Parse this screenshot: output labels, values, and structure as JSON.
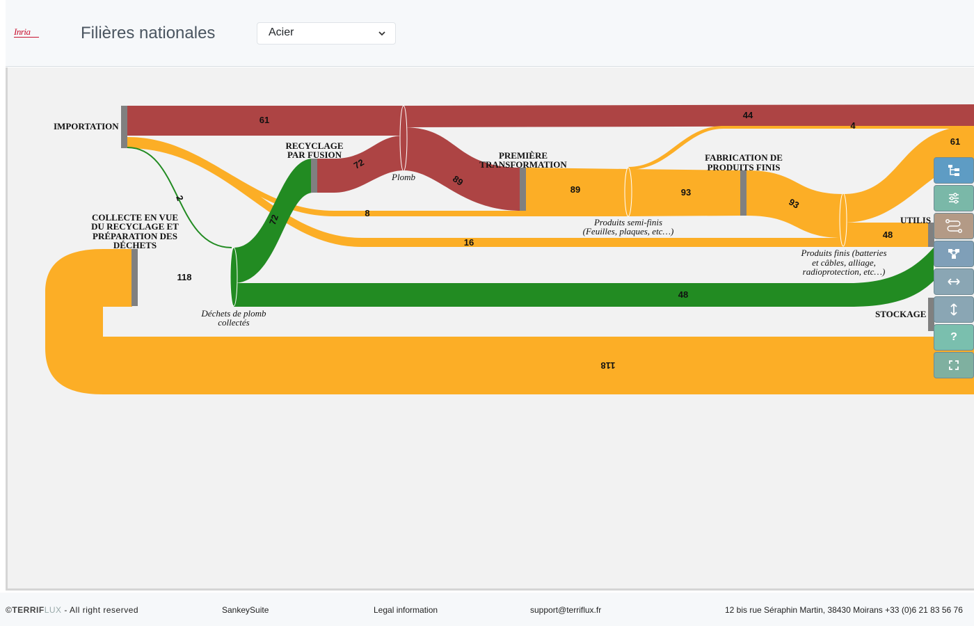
{
  "header": {
    "logo_text": "Inria",
    "title": "Filières nationales",
    "material_select": {
      "value": "Acier"
    }
  },
  "sankey": {
    "nodes": {
      "importation": "IMPORTATION",
      "collecte": [
        "COLLECTE EN VUE",
        "DU RECYCLAGE ET",
        "PRÉPARATION DES",
        "DÉCHETS"
      ],
      "recyclage": [
        "RECYCLAGE",
        "PAR FUSION"
      ],
      "premiere": [
        "PREMIÈRE",
        "TRANSFORMATION"
      ],
      "fabrication": [
        "FABRICATION DE",
        "PRODUITS FINIS"
      ],
      "utilisation": "UTILIS",
      "stockage": "STOCKAGE"
    },
    "products": {
      "plomb": "Plomb",
      "dechets": [
        "Déchets de plomb",
        "collectés"
      ],
      "semi_finis": [
        "Produits semi-finis",
        "(Feuilles, plaques, etc…)"
      ],
      "finis": [
        "Produits finis (batteries",
        "et câbles, alliage,",
        "radioprotection, etc…)"
      ]
    },
    "flow_values": {
      "import_plomb": "61",
      "plomb_export": "44",
      "orange_top": "4",
      "util_61": "61",
      "import_collecte": "2",
      "import_8": "8",
      "import_16": "16",
      "recycl_plomb": "72",
      "collecte_recycl": "72",
      "plomb_premiere": "89",
      "premiere_semi": "89",
      "semi_fab": "93",
      "fab_finis": "93",
      "finis_util": "48",
      "dechets_collecte": "118",
      "dechets_stockage": "48",
      "loop": "118"
    },
    "colors": {
      "plomb": "#ad4444",
      "orange": "#fcae26",
      "green": "#228b22",
      "node": "#808080",
      "background": "#f2f2f2"
    }
  },
  "toolbar": {
    "buttons": [
      {
        "icon": "tree-icon",
        "color": "#5e9cc4"
      },
      {
        "icon": "sliders-icon",
        "color": "#7ab8a8"
      },
      {
        "icon": "route-icon",
        "color": "#b39a86"
      },
      {
        "icon": "hierarchy-icon",
        "color": "#7f9fb8"
      },
      {
        "icon": "horizontal-arrows-icon",
        "color": "#8aa6b4"
      },
      {
        "icon": "vertical-arrows-icon",
        "color": "#8aa6b4"
      },
      {
        "icon": "help-icon",
        "color": "#7abfae"
      },
      {
        "icon": "fullscreen-icon",
        "color": "#7fb0a0"
      }
    ],
    "help_label": "?"
  },
  "footer": {
    "copyright_symbol": "©",
    "brand_a": "TERRIF",
    "brand_b": "LUX",
    "rights": " - All right reserved",
    "suite": "SankeySuite",
    "legal": "Legal information",
    "email": "support@terriflux.fr",
    "address": "12 bis rue Séraphin Martin, 38430 Moirans +33 (0)6 21 83 56 76"
  }
}
